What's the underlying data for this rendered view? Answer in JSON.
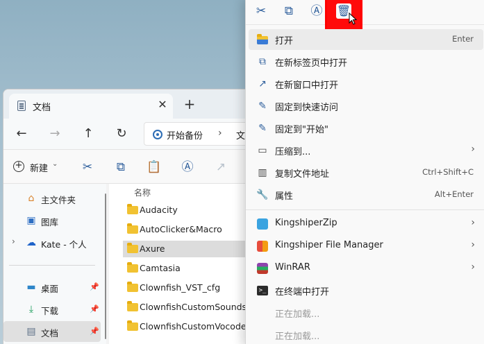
{
  "explorer": {
    "tab_title": "文档",
    "tab_close": "✕",
    "new_tab": "+",
    "address": {
      "crumb1": "开始备份",
      "separator": "›",
      "crumb2": "文"
    },
    "toolbar": {
      "new_label": "新建",
      "new_caret": "⌄"
    },
    "sidebar": {
      "items": [
        {
          "label": "主文件夹",
          "icon": "home-icon"
        },
        {
          "label": "图库",
          "icon": "gallery-icon"
        },
        {
          "label": "Kate - 个人",
          "icon": "onedrive-icon",
          "expand": "›"
        },
        {
          "label": "桌面",
          "icon": "desktop-icon",
          "pin": "📌"
        },
        {
          "label": "下载",
          "icon": "download-icon",
          "pin": "📌"
        },
        {
          "label": "文档",
          "icon": "document-icon",
          "pin": "📌"
        }
      ]
    },
    "filelist": {
      "column_header": "名称",
      "files": [
        "Audacity",
        "AutoClicker&Macro",
        "Axure",
        "Camtasia",
        "Clownfish_VST_cfg",
        "ClownfishCustomSounds",
        "ClownfishCustomVocoders"
      ]
    }
  },
  "context_menu": {
    "items": [
      {
        "label": "打开",
        "shortcut": "Enter"
      },
      {
        "label": "在新标签页中打开"
      },
      {
        "label": "在新窗口中打开"
      },
      {
        "label": "固定到快速访问"
      },
      {
        "label": "固定到\"开始\""
      },
      {
        "label": "压缩到...",
        "arrow": "›"
      },
      {
        "label": "复制文件地址",
        "shortcut": "Ctrl+Shift+C"
      },
      {
        "label": "属性",
        "shortcut": "Alt+Enter"
      },
      {
        "label": "KingshiperZip",
        "arrow": "›"
      },
      {
        "label": "Kingshiper File Manager",
        "arrow": "›"
      },
      {
        "label": "WinRAR",
        "arrow": "›"
      },
      {
        "label": "在终端中打开"
      },
      {
        "label": "正在加载..."
      },
      {
        "label": "正在加载..."
      }
    ]
  },
  "colors": {
    "accent": "#2e5f9c",
    "highlight_box": "#ff0000",
    "folder": "#f1c232"
  }
}
